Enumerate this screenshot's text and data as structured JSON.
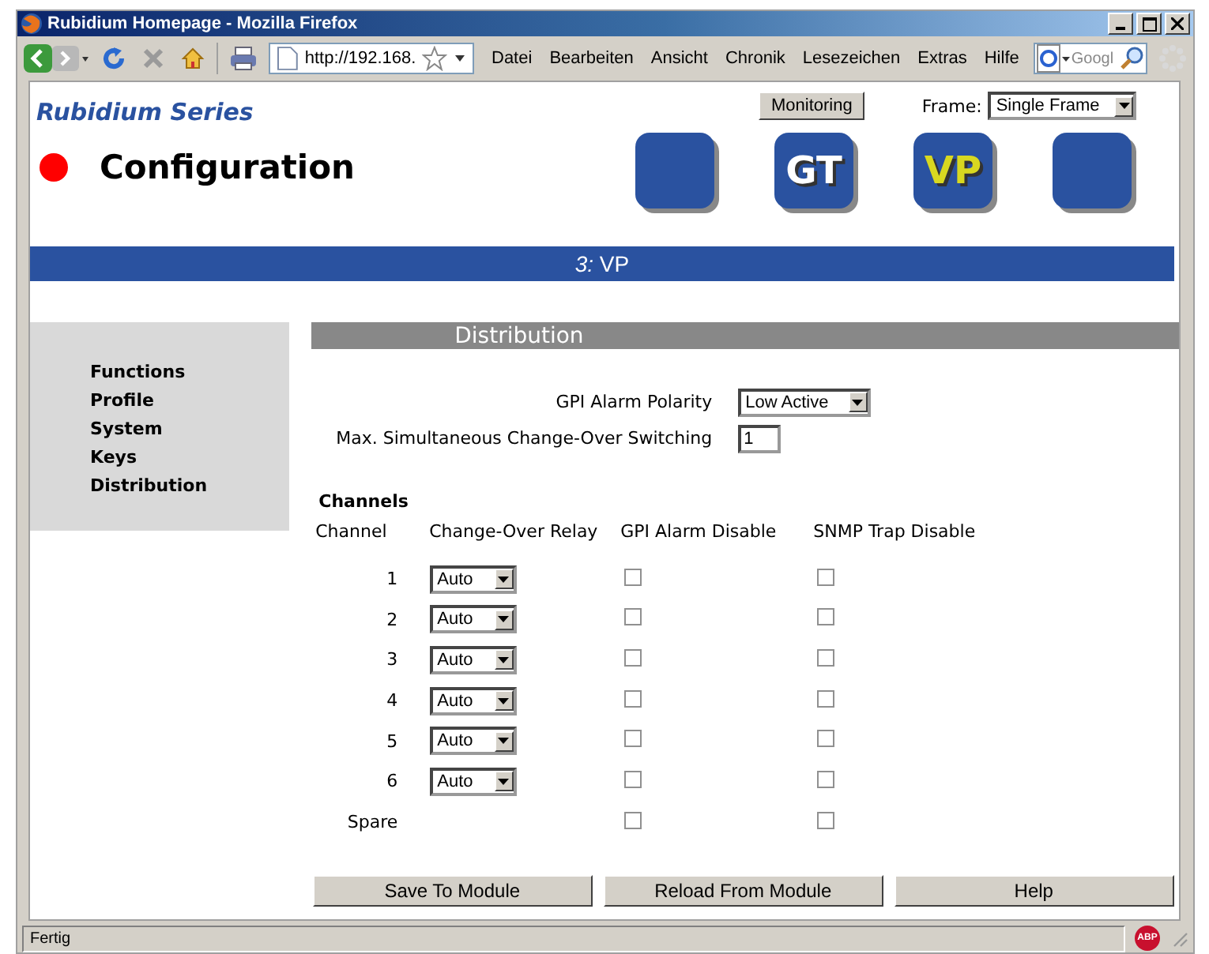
{
  "window": {
    "title": "Rubidium Homepage - Mozilla Firefox"
  },
  "toolbar": {
    "url": "http://192.168.",
    "menus": [
      "Datei",
      "Bearbeiten",
      "Ansicht",
      "Chronik",
      "Lesezeichen",
      "Extras",
      "Hilfe"
    ],
    "search": {
      "placeholder": "Googl"
    }
  },
  "header": {
    "brand": "Rubidium Series",
    "monitoring_button": "Monitoring",
    "frame_label": "Frame:",
    "frame_value": "Single Frame",
    "page_title": "Configuration",
    "tiles": [
      {
        "kind": "blank"
      },
      {
        "kind": "plain",
        "label": "GT"
      },
      {
        "kind": "highlight",
        "label": "VP"
      },
      {
        "kind": "blank"
      }
    ]
  },
  "module_bar": {
    "text": "*3:* VP"
  },
  "sidebar": {
    "items": [
      "Functions",
      "Profile",
      "System",
      "Keys",
      "Distribution"
    ]
  },
  "section": {
    "title": "Distribution",
    "gpi_polarity_label": "GPI Alarm Polarity",
    "gpi_polarity_value": "Low Active",
    "max_switching_label": "Max. Simultaneous Change-Over Switching",
    "max_switching_value": "1",
    "channels_title": "Channels",
    "columns": [
      "Channel",
      "Change-Over Relay",
      "GPI Alarm Disable",
      "SNMP Trap Disable"
    ],
    "rows": [
      {
        "channel": "1",
        "relay": "Auto",
        "gpi_alarm_disable": false,
        "snmp_trap_disable": false
      },
      {
        "channel": "2",
        "relay": "Auto",
        "gpi_alarm_disable": false,
        "snmp_trap_disable": false
      },
      {
        "channel": "3",
        "relay": "Auto",
        "gpi_alarm_disable": false,
        "snmp_trap_disable": false
      },
      {
        "channel": "4",
        "relay": "Auto",
        "gpi_alarm_disable": false,
        "snmp_trap_disable": false
      },
      {
        "channel": "5",
        "relay": "Auto",
        "gpi_alarm_disable": false,
        "snmp_trap_disable": false
      },
      {
        "channel": "6",
        "relay": "Auto",
        "gpi_alarm_disable": false,
        "snmp_trap_disable": false
      },
      {
        "channel": "Spare",
        "gpi_alarm_disable": false,
        "snmp_trap_disable": false
      }
    ],
    "buttons": [
      "Save To Module",
      "Reload From Module",
      "Help"
    ]
  },
  "status_bar": {
    "text": "Fertig",
    "adblock_label": "ABP"
  }
}
